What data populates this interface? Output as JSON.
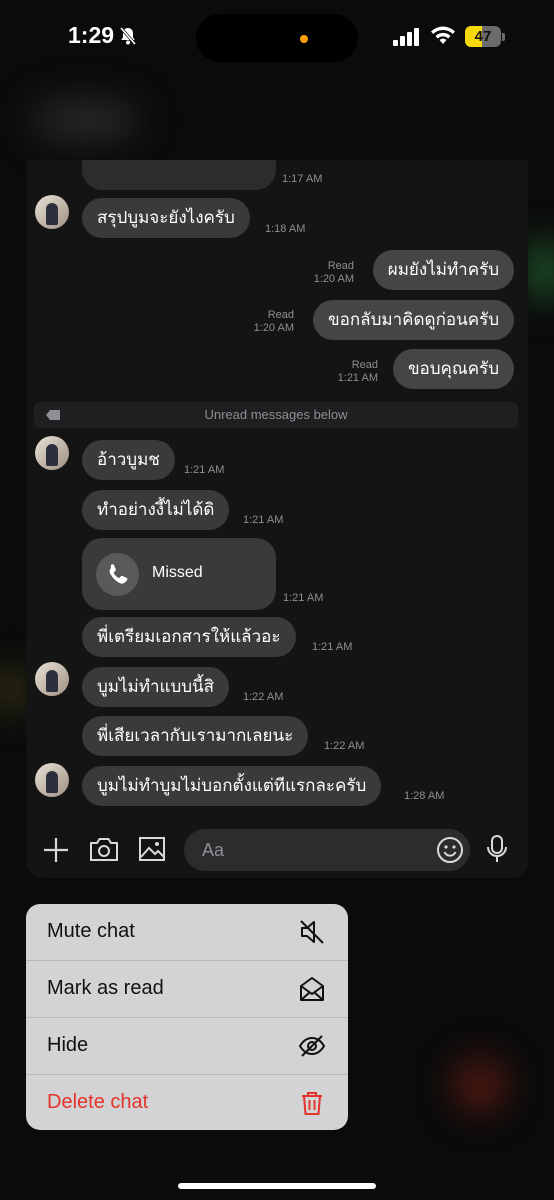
{
  "status_bar": {
    "time": "1:29",
    "battery": "47",
    "battery_level": 0.47
  },
  "chat": {
    "messages_top": [
      {
        "time": "1:17 AM"
      }
    ],
    "messages": [
      {
        "id": "m1",
        "direction": "in",
        "text": "สรุปบูมจะยังไงครับ",
        "time": "1:18 AM"
      },
      {
        "id": "m2",
        "direction": "out",
        "text": "ผมยังไม่ทำครับ",
        "read": "Read",
        "time": "1:20 AM"
      },
      {
        "id": "m3",
        "direction": "out",
        "text": "ขอกลับมาคิดดูก่อนครับ",
        "read": "Read",
        "time": "1:20 AM"
      },
      {
        "id": "m4",
        "direction": "out",
        "text": "ขอบคุณครับ",
        "read": "Read",
        "time": "1:21 AM"
      }
    ],
    "unread_divider": "Unread messages below",
    "messages_after": [
      {
        "id": "m5",
        "text": "อ้าวบูมช",
        "time": "1:21 AM"
      },
      {
        "id": "m6",
        "text": "ทำอย่างงี้ไม่ได้ดิ",
        "time": "1:21 AM"
      },
      {
        "id": "m7",
        "text": "Missed",
        "time": "1:21 AM",
        "type": "call"
      },
      {
        "id": "m8",
        "text": "พี่เตรียมเอกสารให้แล้วอะ",
        "time": "1:21 AM"
      },
      {
        "id": "m9",
        "text": "บูมไม่ทำแบบนี้สิ",
        "time": "1:22 AM"
      },
      {
        "id": "m10",
        "text": "พี่เสียเวลากับเรามากเลยนะ",
        "time": "1:22 AM"
      },
      {
        "id": "m11",
        "text": "บูมไม่ทำบูมไม่บอกตั้งแต่ทีแรกละครับ",
        "time": "1:28 AM"
      }
    ]
  },
  "composer": {
    "placeholder": "Aa"
  },
  "context_menu": {
    "items": [
      {
        "label": "Mute chat",
        "icon": "speaker-mute-icon"
      },
      {
        "label": "Mark as read",
        "icon": "envelope-open-icon"
      },
      {
        "label": "Hide",
        "icon": "eye-slash-icon"
      },
      {
        "label": "Delete chat",
        "icon": "trash-icon",
        "danger": true
      }
    ]
  },
  "colors": {
    "accent_danger": "#e5332a",
    "battery": "#f5d90a",
    "bubble": "#3a3a3c",
    "menu_bg": "#d3d3d6"
  }
}
